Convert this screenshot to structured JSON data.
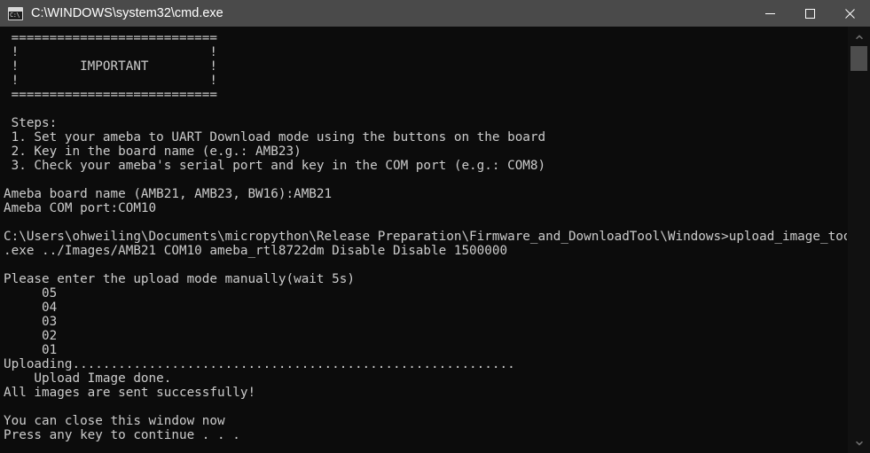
{
  "window": {
    "title": "C:\\WINDOWS\\system32\\cmd.exe",
    "icon_prompt": "C:\\",
    "titlebar_bg": "#4a4a4a",
    "console_bg": "#0c0c0c",
    "console_fg": "#cccccc",
    "buttons": {
      "minimize_label": "Minimize",
      "maximize_label": "Maximize",
      "close_label": "Close"
    }
  },
  "scrollbar": {
    "up_label": "Scroll up",
    "down_label": "Scroll down",
    "thumb_label": "Scroll thumb"
  },
  "console": {
    "lines": [
      " ===========================",
      " !                         !",
      " !        IMPORTANT        !",
      " !                         !",
      " ===========================",
      "",
      " Steps:",
      " 1. Set your ameba to UART Download mode using the buttons on the board",
      " 2. Key in the board name (e.g.: AMB23)",
      " 3. Check your ameba's serial port and key in the COM port (e.g.: COM8)",
      "",
      "Ameba board name (AMB21, AMB23, BW16):AMB21",
      "Ameba COM port:COM10",
      "",
      "C:\\Users\\ohweiling\\Documents\\micropython\\Release Preparation\\Firmware_and_DownloadTool\\Windows>upload_image_tool_windows",
      ".exe ../Images/AMB21 COM10 ameba_rtl8722dm Disable Disable 1500000",
      "",
      "Please enter the upload mode manually(wait 5s)",
      "     05",
      "     04",
      "     03",
      "     02",
      "     01",
      "Uploading..........................................................",
      "    Upload Image done.",
      "All images are sent successfully!",
      "",
      "You can close this window now",
      "Press any key to continue . . ."
    ]
  }
}
